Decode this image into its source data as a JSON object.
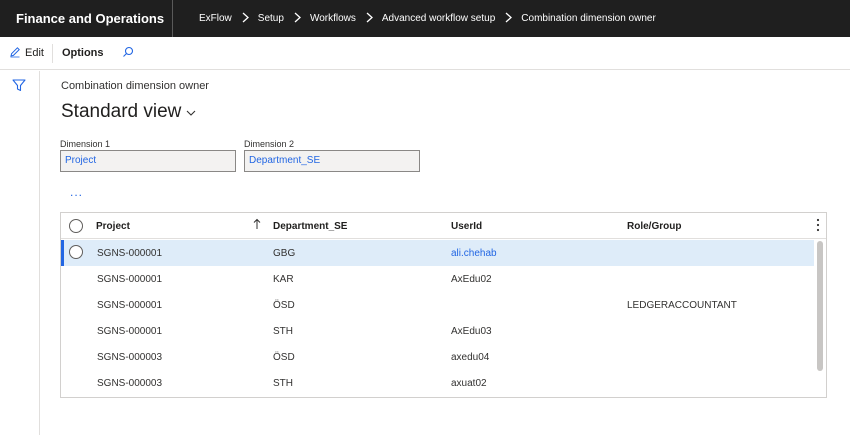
{
  "app": {
    "title": "Finance and Operations"
  },
  "breadcrumbs": [
    "ExFlow",
    "Setup",
    "Workflows",
    "Advanced workflow setup",
    "Combination dimension owner"
  ],
  "actions": {
    "edit_label": "Edit",
    "options_label": "Options"
  },
  "page": {
    "caption": "Combination dimension owner",
    "view_title": "Standard view"
  },
  "fields": {
    "dimension1": {
      "label": "Dimension 1",
      "value": "Project"
    },
    "dimension2": {
      "label": "Dimension 2",
      "value": "Department_SE"
    }
  },
  "more_label": "...",
  "grid": {
    "columns": [
      "Project",
      "Department_SE",
      "UserId",
      "Role/Group"
    ],
    "rows": [
      {
        "project": "SGNS-000001",
        "department": "GBG",
        "userid": "ali.chehab",
        "role": ""
      },
      {
        "project": "SGNS-000001",
        "department": "KAR",
        "userid": "AxEdu02",
        "role": ""
      },
      {
        "project": "SGNS-000001",
        "department": "ÖSD",
        "userid": "",
        "role": "LEDGERACCOUNTANT"
      },
      {
        "project": "SGNS-000001",
        "department": "STH",
        "userid": "AxEdu03",
        "role": ""
      },
      {
        "project": "SGNS-000003",
        "department": "ÖSD",
        "userid": "axedu04",
        "role": ""
      },
      {
        "project": "SGNS-000003",
        "department": "STH",
        "userid": "axuat02",
        "role": ""
      }
    ]
  },
  "colors": {
    "accent": "#2266e3",
    "topbar": "#1f1f1f",
    "selected_row": "#deecf9"
  },
  "icons": [
    "pencil-icon",
    "search-icon",
    "filter-icon",
    "chevron-right-icon",
    "chevron-down-icon",
    "sort-up-arrow-icon",
    "more-vertical-icon"
  ]
}
